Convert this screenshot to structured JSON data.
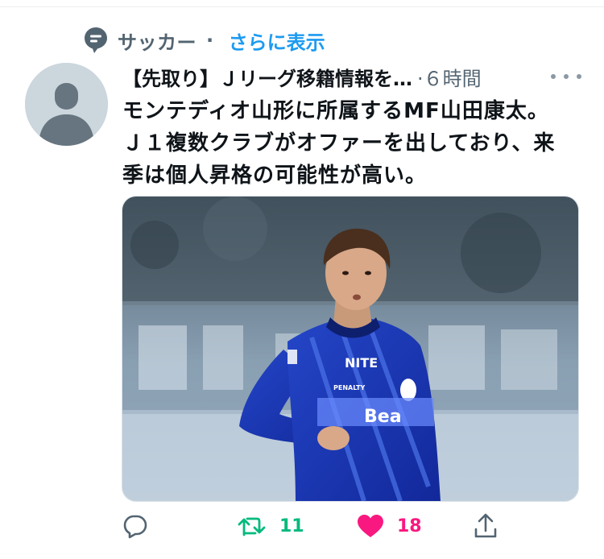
{
  "context": {
    "category": "サッカー",
    "separator": "·",
    "link": "さらに表示"
  },
  "tweet": {
    "title": "【先取り】Ｊリーグ移籍情報を…",
    "time": "·６時間",
    "body_lines": [
      "モンテディオ山形に所属するMF山田康太。",
      "Ｊ１複数クラブがオファーを出しており、来",
      "季は個人昇格の可能性が高い。"
    ]
  },
  "media": {
    "description": "photo-soccer-player",
    "jersey_sponsor": "NITE",
    "jersey_logo": "PENALTY",
    "chest_text": "Bea"
  },
  "actions": {
    "reply": {
      "icon": "reply-icon",
      "count": ""
    },
    "retweet": {
      "icon": "retweet-icon",
      "count": "11",
      "color": "#00ba7c"
    },
    "like": {
      "icon": "heart-icon",
      "count": "18",
      "color": "#f91880"
    },
    "share": {
      "icon": "share-icon"
    }
  },
  "colors": {
    "accent": "#1d9bf0",
    "secondary_text": "#536471",
    "primary_text": "#0f1419"
  }
}
